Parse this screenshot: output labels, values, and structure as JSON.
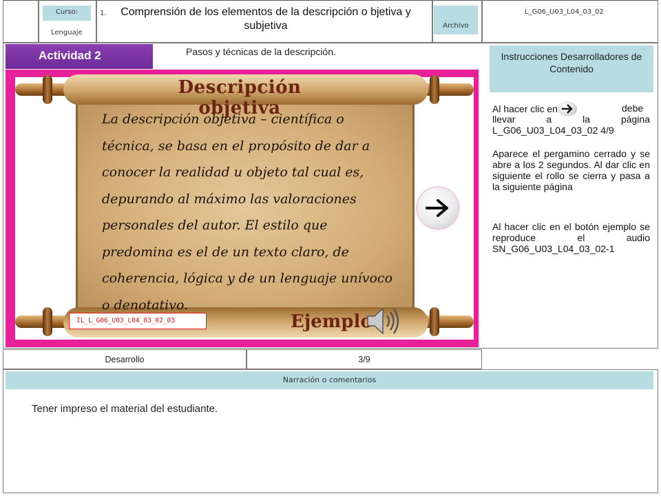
{
  "header": {
    "curso_label": "Curso:",
    "curso_value": "Lenguaje",
    "item_number": "1.",
    "title": "Comprensión de los elementos de la descripción o bjetiva y subjetiva",
    "archivo_label": "Archivo",
    "file_code": "L_G06_U03_L04_03_02"
  },
  "activity": {
    "tag": "Actividad 2",
    "subtitle": "Pasos y técnicas de la descripción."
  },
  "scroll": {
    "heading": "Descripción objetiva",
    "body": "La descripción objetiva – científica o técnica, se basa en el propósito de dar a conocer la realidad u objeto tal cual es, depurando al máximo las valoraciones personales del autor. El estilo que predomina es el de un texto claro, de coherencia, lógica y de un lenguaje unívoco o denotativo.",
    "example_label": "Ejemplo",
    "image_code": "IL_L_G06_U03_L04_03_02_03"
  },
  "instructions": {
    "heading": "Instrucciones Desarrolladores de Contenido",
    "p1_before": "Al hacer clic en",
    "p1_after": "debe llevar a la página L_G06_U03_L04_03_02 4/9",
    "p2": "Aparece el pergamino cerrado y se abre a los 2 segundos. Al dar clic en siguiente el rollo se cierra y pasa a la siguiente página",
    "p3": "Al hacer clic en el botón ejemplo se reproduce el audio SN_G06_U03_L04_03_02-1"
  },
  "footer": {
    "phase": "Desarrollo",
    "page": "3/9",
    "narration_heading": "Narración o comentarios",
    "narration_text": "Tener impreso el material del estudiante."
  },
  "colors": {
    "accent_teal": "#b7dde2",
    "activity_purple": "#7a33a3",
    "frame_pink": "#e8219a",
    "code_red": "#d61b1b"
  },
  "icons": [
    "next-arrow-icon",
    "speaker-icon"
  ]
}
